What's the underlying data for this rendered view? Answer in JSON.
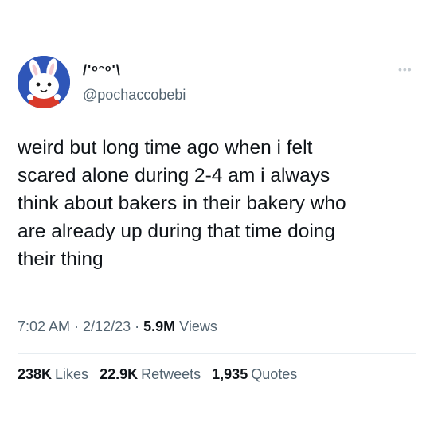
{
  "author": {
    "display_name": "/'ᵒᵔᵒ'\\",
    "handle": "@pochaccobebi",
    "avatar_icon": "bunny-avatar"
  },
  "more_icon": "more-dots-icon",
  "tweet": {
    "lines": [
      "weird but long time ago when i felt",
      "scared alone during 2-4 am i always",
      "think about bakers in their bakery who",
      "are already up during that time doing",
      "their thing"
    ]
  },
  "meta": {
    "time": "7:02 AM",
    "date": "2/12/23",
    "views_count": "5.9M",
    "views_label": "Views",
    "separator": "·"
  },
  "stats": {
    "likes_count": "238K",
    "likes_label": "Likes",
    "retweets_count": "22.9K",
    "retweets_label": "Retweets",
    "quotes_count": "1,935",
    "quotes_label": "Quotes"
  },
  "colors": {
    "text": "#0f1419",
    "secondary": "#536471",
    "divider": "#e6ecf0",
    "avatar_bg": "#2f56b8"
  }
}
